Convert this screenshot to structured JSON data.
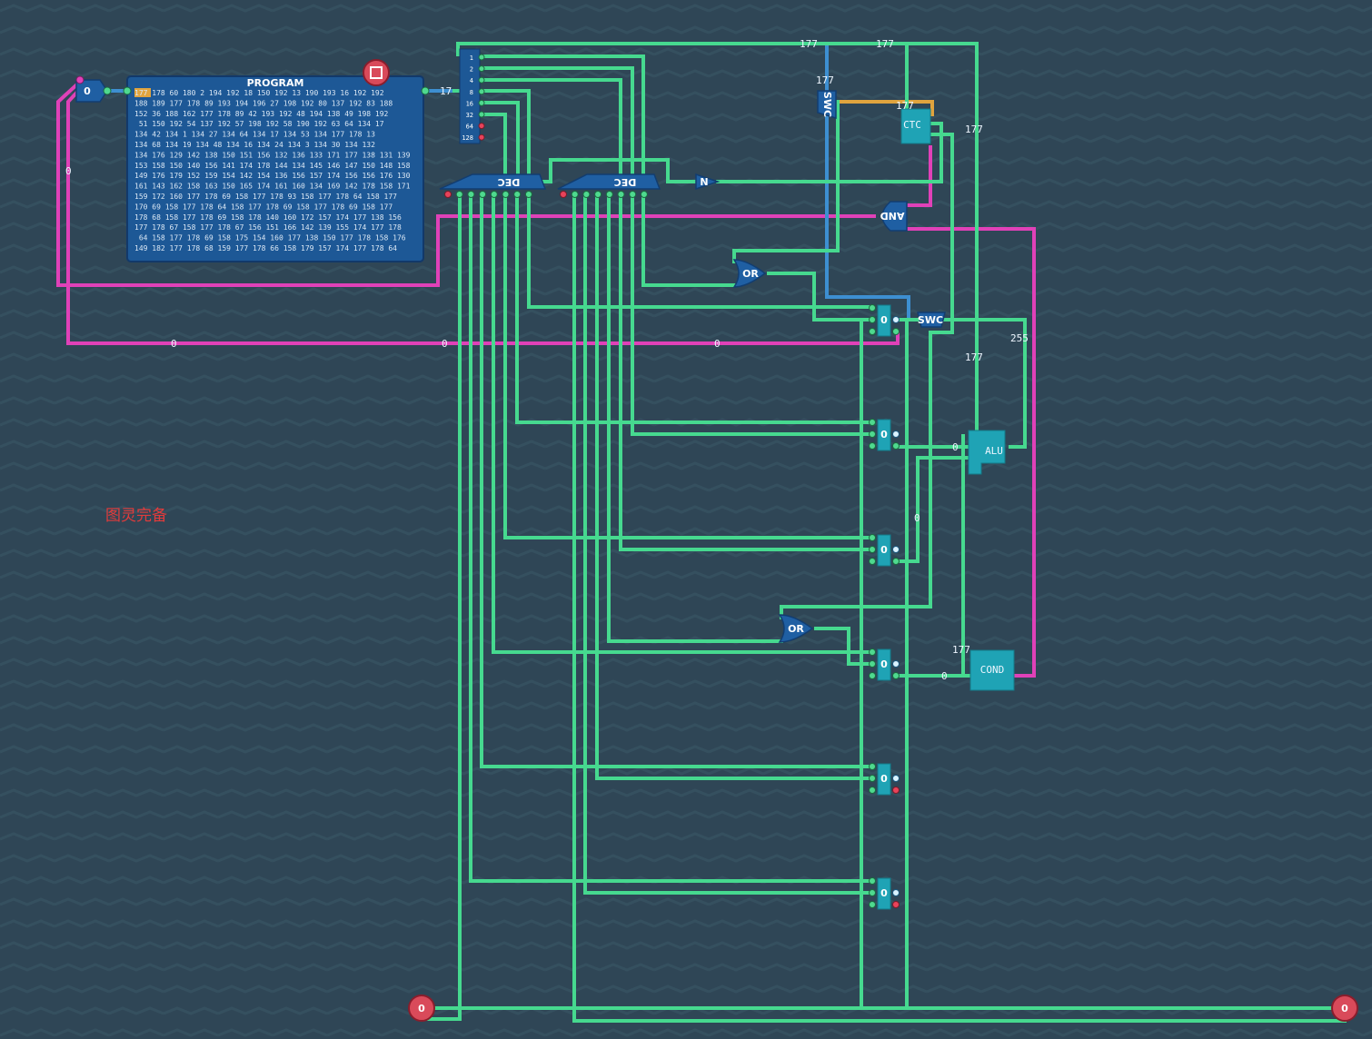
{
  "watermark": "图灵完备",
  "program": {
    "title": "PROGRAM",
    "address_value": "0",
    "output_value": "17",
    "rows": [
      "177 178 60 180  2  194 192  18 150 192  13 190 193  16 192 192",
      "188 189 177 178  89 193 194 196  27 198 192  80 137 192  83 188",
      "152  36 188 162 177 178  89  42 193 192  48 194 138  49 198 192",
      " 51 150 192  54 137 192  57 198 192  58 190 192  63  64 134  17",
      "134  42 134   1 134  27 134  64 134  17 134  53 134 177 178  13",
      "134  68 134  19 134  48 134  16 134  24 134   3 134  30 134 132",
      "134 176 129 142 138 150 151 156 132 136 133 171 177 138 131 139",
      "153 158 150 140 156 141 174 178 144 134 145 146 147 150 148 158",
      "149 176 179 152 159 154 142 154 136 156 157 174 156 156 176 130",
      "161 143 162 158 163 150 165 174 161 160 134 169 142 178 158 171",
      "159 172 160 177 178  69 158 177 178  93 158 177 178  64 158 177",
      "170  69 158 177 178  64 158 177 178  69 158 177 178  69 158 177",
      "178  68 158 177 178  69 158 178 140 160 172 157 174 177 138 156",
      "177 178  67 158 177 178  67 156 151 166 142 139 155 174 177 178",
      " 64 158 177 178  69 158 175 154 160 177 138 150 177 178 158 176",
      "149 182 177 178  68 159 177 178  66 158 179 157 174 177 178  64"
    ]
  },
  "components": {
    "decoder_1": "DEC",
    "decoder_2": "DEC",
    "not_gate": "N",
    "or_gate_1": "OR",
    "or_gate_2": "OR",
    "and_gate": "AND",
    "switch_1": "SWC",
    "switch_2": "SWC",
    "counter": "CTC",
    "alu": "ALU",
    "cond": "COND",
    "byte_input_left": "0",
    "byte_input_right": "0"
  },
  "bit_labels": [
    "1",
    "2",
    "4",
    "8",
    "16",
    "32",
    "64",
    "128"
  ],
  "registers": [
    {
      "id": "reg_0",
      "value": "0"
    },
    {
      "id": "reg_1",
      "value": "0"
    },
    {
      "id": "reg_2",
      "value": "0"
    },
    {
      "id": "reg_3",
      "value": "0"
    },
    {
      "id": "reg_4",
      "value": "0"
    },
    {
      "id": "reg_5",
      "value": "0"
    }
  ],
  "wire_values": {
    "top_bus_left": "177",
    "top_bus_right": "177",
    "swc_top": "177",
    "ctc_in": "177",
    "ctc_out": "177",
    "alu_in": "177",
    "alu_out": "255",
    "alu_left": "0",
    "mid_reg": "0",
    "cond_top": "177",
    "cond_left": "0",
    "loop_left": "0",
    "loop_mid1": "0",
    "loop_mid2": "0",
    "loop_mid3": "0"
  },
  "colors": {
    "background": "#2f4656",
    "wire_green": "#46d98f",
    "wire_pink": "#e041b8",
    "wire_blue": "#3d8fd1",
    "wire_orange": "#e0a43e",
    "component_blue": "#1f5fa3",
    "register_teal": "#1fa3b5",
    "watermark_red": "#e33b3b"
  }
}
